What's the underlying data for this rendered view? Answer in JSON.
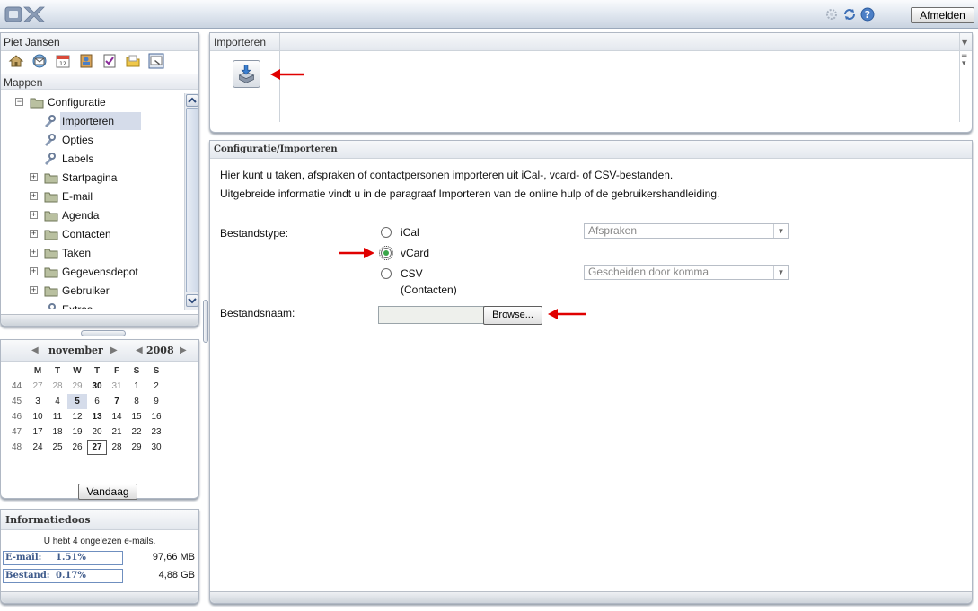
{
  "header": {
    "logo_text": "OX",
    "logout_label": "Afmelden",
    "icons": [
      "settings-icon",
      "refresh-icon",
      "help-icon"
    ]
  },
  "sidebar": {
    "user_name": "Piet Jansen",
    "app_icons": [
      "home-icon",
      "email-icon",
      "calendar-icon",
      "contacts-icon",
      "tasks-icon",
      "infostore-icon",
      "configuration-icon"
    ],
    "folders_label": "Mappen",
    "tree": [
      {
        "label": "Configuratie",
        "level": 0,
        "expander": "−"
      },
      {
        "label": "Importeren",
        "level": 1,
        "selected": true
      },
      {
        "label": "Opties",
        "level": 1
      },
      {
        "label": "Labels",
        "level": 1
      },
      {
        "label": "Startpagina",
        "level": 0,
        "expander": "+"
      },
      {
        "label": "E-mail",
        "level": 0,
        "expander": "+"
      },
      {
        "label": "Agenda",
        "level": 0,
        "expander": "+"
      },
      {
        "label": "Contacten",
        "level": 0,
        "expander": "+"
      },
      {
        "label": "Taken",
        "level": 0,
        "expander": "+"
      },
      {
        "label": "Gegevensdepot",
        "level": 0,
        "expander": "+"
      },
      {
        "label": "Gebruiker",
        "level": 0,
        "expander": "+"
      },
      {
        "label": "Extras",
        "level": 1
      }
    ]
  },
  "calendar": {
    "month": "november",
    "year": "2008",
    "weekdays": [
      "M",
      "T",
      "W",
      "T",
      "F",
      "S",
      "S"
    ],
    "weeks": [
      {
        "wk": "44",
        "days": [
          "27",
          "28",
          "29",
          "30",
          "31",
          "1",
          "2"
        ]
      },
      {
        "wk": "45",
        "days": [
          "3",
          "4",
          "5",
          "6",
          "7",
          "8",
          "9"
        ]
      },
      {
        "wk": "46",
        "days": [
          "10",
          "11",
          "12",
          "13",
          "14",
          "15",
          "16"
        ]
      },
      {
        "wk": "47",
        "days": [
          "17",
          "18",
          "19",
          "20",
          "21",
          "22",
          "23"
        ]
      },
      {
        "wk": "48",
        "days": [
          "24",
          "25",
          "26",
          "27",
          "28",
          "29",
          "30"
        ]
      }
    ],
    "today_label": "Vandaag"
  },
  "infobox": {
    "title": "Informatiedoos",
    "message": "U hebt 4 ongelezen e-mails.",
    "email_label": "E-mail:",
    "email_percent": "1.51%",
    "email_size": "97,66 MB",
    "file_label": "Bestand:",
    "file_percent": "0.17%",
    "file_size": "4,88 GB"
  },
  "toolbar": {
    "tab_label": "Importeren",
    "import_icon": "import-icon"
  },
  "content": {
    "breadcrumb": "Configuratie/Importeren",
    "description_line1": "Hier kunt u taken, afspraken of contactpersonen importeren uit iCal-, vcard- of CSV-bestanden.",
    "description_line2": "Uitgebreide informatie vindt u in de paragraaf Importeren van de online hulp of de gebruikershandleiding.",
    "filetype_label": "Bestandstype:",
    "options": [
      {
        "label": "iCal",
        "checked": false
      },
      {
        "label": "vCard",
        "checked": true
      },
      {
        "label": "CSV (Contacten)",
        "checked": false
      }
    ],
    "ical_select": "Afspraken",
    "csv_select": "Gescheiden door komma",
    "filename_label": "Bestandsnaam:",
    "browse_label": "Browse..."
  },
  "colors": {
    "annotation_arrow": "#e00000",
    "selected_bg": "#d5dcea",
    "radio_checked": "#3aa64a"
  }
}
